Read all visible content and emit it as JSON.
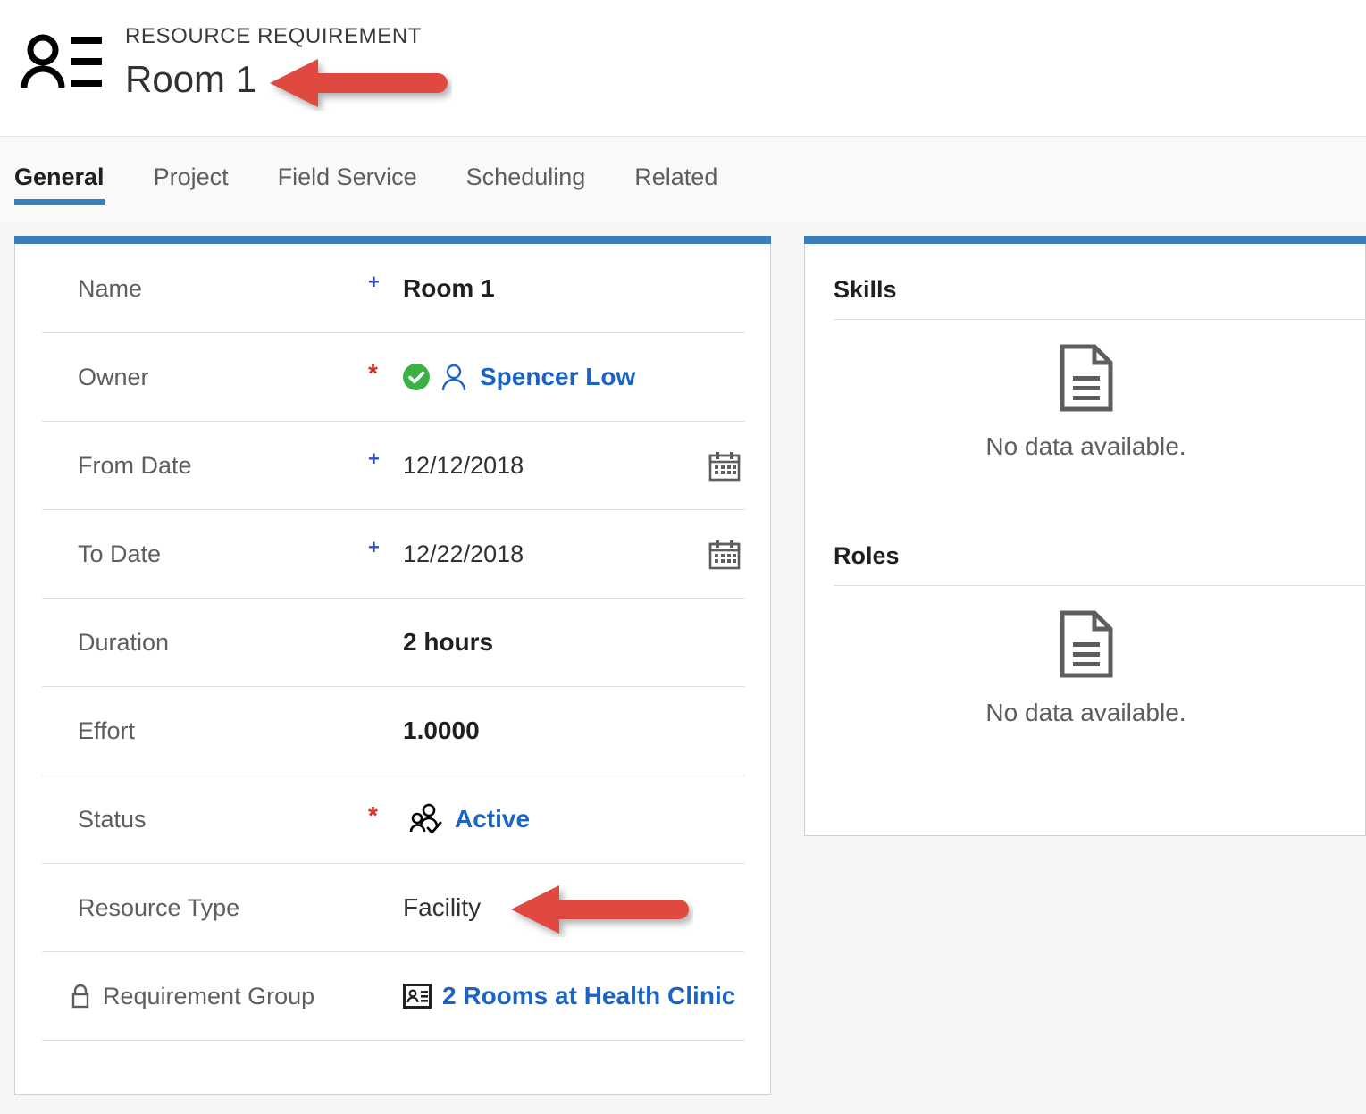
{
  "header": {
    "icon": "contact-card-icon",
    "eyebrow": "RESOURCE REQUIREMENT",
    "title": "Room 1"
  },
  "tabs": [
    {
      "label": "General",
      "selected": true
    },
    {
      "label": "Project",
      "selected": false
    },
    {
      "label": "Field Service",
      "selected": false
    },
    {
      "label": "Scheduling",
      "selected": false
    },
    {
      "label": "Related",
      "selected": false
    }
  ],
  "form": {
    "rows": [
      {
        "label": "Name",
        "required_marker": "+",
        "value": "Room 1",
        "value_style": "bold",
        "value_icon": "",
        "trailing_icon": ""
      },
      {
        "label": "Owner",
        "required_marker": "*",
        "value": "Spencer Low",
        "value_style": "link",
        "value_icon": "owner-person-icon",
        "status_icon": "green-check-icon",
        "trailing_icon": ""
      },
      {
        "label": "From Date",
        "required_marker": "+",
        "value": "12/12/2018",
        "value_style": "date",
        "value_icon": "",
        "trailing_icon": "calendar-icon"
      },
      {
        "label": "To Date",
        "required_marker": "+",
        "value": "12/22/2018",
        "value_style": "date",
        "value_icon": "",
        "trailing_icon": "calendar-icon"
      },
      {
        "label": "Duration",
        "required_marker": "",
        "value": "2 hours",
        "value_style": "bold",
        "value_icon": "",
        "trailing_icon": ""
      },
      {
        "label": "Effort",
        "required_marker": "",
        "value": "1.0000",
        "value_style": "bold",
        "value_icon": "",
        "trailing_icon": ""
      },
      {
        "label": "Status",
        "required_marker": "*",
        "value": "Active",
        "value_style": "link",
        "value_icon": "people-check-icon",
        "trailing_icon": ""
      },
      {
        "label": "Resource Type",
        "required_marker": "",
        "value": "Facility",
        "value_style": "plain",
        "value_icon": "",
        "trailing_icon": ""
      },
      {
        "label": "Requirement Group",
        "label_icon": "lock-icon",
        "required_marker": "",
        "value": "2 Rooms at Health Clinic",
        "value_style": "link",
        "value_icon": "id-badge-icon",
        "trailing_icon": ""
      }
    ]
  },
  "side": {
    "subgrids": [
      {
        "title": "Skills",
        "empty_icon": "document-icon",
        "empty_text": "No data available."
      },
      {
        "title": "Roles",
        "empty_icon": "document-icon",
        "empty_text": "No data available."
      }
    ]
  },
  "annotations": [
    {
      "name": "arrow-pointing-at-title",
      "direction": "left"
    },
    {
      "name": "arrow-pointing-at-resource-type",
      "direction": "left"
    }
  ],
  "colors": {
    "accent_blue": "#3a7ebf",
    "link_blue": "#1b64c4",
    "required_red": "#d93025",
    "optional_blue": "#2b4cd5",
    "success_green": "#3bb143",
    "callout_red": "#e04a3f",
    "page_background": "#f7f6f5"
  }
}
